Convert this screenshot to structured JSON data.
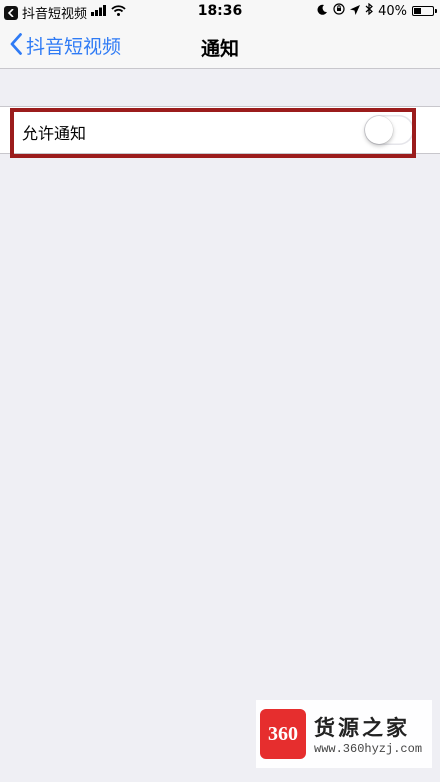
{
  "status_bar": {
    "app_name": "抖音短视频",
    "time": "18:36",
    "battery_percent_label": "40%",
    "battery_level": 0.4
  },
  "nav": {
    "back_label": "抖音短视频",
    "title": "通知",
    "accent_color": "#2f7bf5"
  },
  "settings": {
    "allow_notifications_label": "允许通知",
    "allow_notifications_on": false
  },
  "watermark": {
    "logo_text": "360",
    "title": "货源之家",
    "url": "www.360hyzj.com"
  },
  "colors": {
    "background": "#efeff4",
    "highlight": "#9b1c1c",
    "watermark_logo": "#e62e2e"
  }
}
